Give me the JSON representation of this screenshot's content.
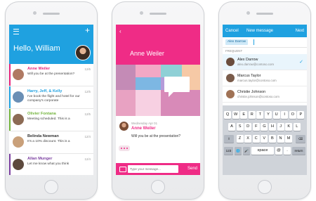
{
  "inbox": {
    "greeting": "Hello, William",
    "messages": [
      {
        "name": "Anne Weiler",
        "date": "12/6",
        "preview": "Will you be at the presentation?",
        "name_color": "#e6237a",
        "avatar_color": "#b07a63"
      },
      {
        "name": "Harry, Jeff, & Kelly",
        "date": "12/5",
        "preview": "I've book the flight and hotel for our company's corporate",
        "name_color": "#1fa1e0",
        "avatar_color": "#6a8fb5"
      },
      {
        "name": "Olivier Fontana",
        "date": "12/5",
        "preview": "Meeting scheduled. This is a",
        "name_color": "#73b43c",
        "avatar_color": "#8c6b55"
      },
      {
        "name": "Belinda Newman",
        "date": "12/4",
        "preview": "It's a 10% discount. This is a",
        "name_color": "#333333",
        "avatar_color": "#c9a07a"
      },
      {
        "name": "Allan Munger",
        "date": "12/4",
        "preview": "Let me know what you think",
        "name_color": "#7b3fa0",
        "avatar_color": "#5d4a3e"
      }
    ]
  },
  "detail": {
    "sender": "Anne Weiler",
    "date": "Wednesday Apr 01",
    "name": "Anne Weiler",
    "body": "Will you be at the presentation?",
    "composer_placeholder": "Type your message...",
    "send_label": "Send"
  },
  "compose": {
    "cancel_label": "Cancel",
    "title": "New message",
    "next_label": "Next",
    "recipient_chip": "Alex Darrow",
    "frequent_label": "FREQUENT",
    "contacts": [
      {
        "name": "Alex Darrow",
        "email": "alex.darrow@contoso.com",
        "selected": true,
        "avatar_color": "#6b4d3d"
      },
      {
        "name": "Marcus Taylor",
        "email": "marcus.taylor@contoso.com",
        "selected": false,
        "avatar_color": "#7a5b4a"
      },
      {
        "name": "Christie Johnson",
        "email": "christie.johnson@contoso.com",
        "selected": false,
        "avatar_color": "#a07255"
      }
    ],
    "keyboard": {
      "row1": [
        "Q",
        "W",
        "E",
        "R",
        "T",
        "Y",
        "U",
        "I",
        "O",
        "P"
      ],
      "row2": [
        "A",
        "S",
        "D",
        "F",
        "G",
        "H",
        "J",
        "K",
        "L"
      ],
      "row3": [
        "Z",
        "X",
        "C",
        "V",
        "B",
        "N",
        "M"
      ],
      "shift": "⇧",
      "backspace": "⌫",
      "numbers": "123",
      "globe": "🌐",
      "mic": "🎤",
      "space": "space",
      "at": "@",
      "dot": ".",
      "return": "return"
    }
  },
  "colors": {
    "outlook_blue": "#1fa1e0",
    "send_pink": "#ef2c86"
  }
}
